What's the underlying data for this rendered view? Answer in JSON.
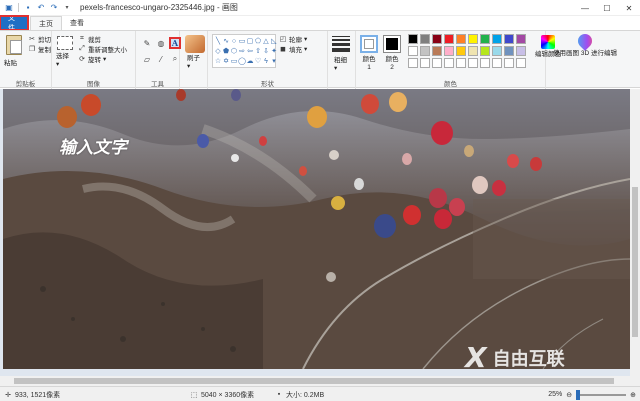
{
  "window": {
    "title": "pexels-francesco-ungaro-2325446.jpg - 画图",
    "minimize": "—",
    "maximize": "☐",
    "close": "✕"
  },
  "tabs": [
    {
      "label": "文件"
    },
    {
      "label": "主页"
    },
    {
      "label": "查看"
    }
  ],
  "ribbon": {
    "clipboard": {
      "paste": "粘贴",
      "cut": "剪切",
      "copy": "复制",
      "group": "剪贴板"
    },
    "image": {
      "select": "选择",
      "crop": "裁剪",
      "resize": "重新调整大小",
      "rotate": "旋转",
      "group": "图像"
    },
    "tools": {
      "group": "工具"
    },
    "brushes": {
      "label": "刷子"
    },
    "shapes": {
      "outline": "轮廓",
      "fill": "填充",
      "group": "形状"
    },
    "size": {
      "label": "粗细"
    },
    "colors": {
      "color1": "颜色 1",
      "color2": "颜色 2",
      "edit": "编辑颜色",
      "group": "颜色",
      "palette": [
        "#000000",
        "#7f7f7f",
        "#880015",
        "#ed1c24",
        "#ff7f27",
        "#fff200",
        "#22b14c",
        "#00a2e8",
        "#3f48cc",
        "#a349a4",
        "#ffffff",
        "#c3c3c3",
        "#b97a57",
        "#ffaec9",
        "#ffc90e",
        "#efe4b0",
        "#b5e61d",
        "#99d9ea",
        "#7092be",
        "#c8bfe7",
        "#ffffff",
        "#ffffff",
        "#ffffff",
        "#ffffff",
        "#ffffff",
        "#ffffff",
        "#ffffff",
        "#ffffff",
        "#ffffff",
        "#ffffff"
      ]
    },
    "paint3d": "使用画图 3D 进行编辑"
  },
  "canvas": {
    "overlay_text": "输入文字",
    "watermark": "自由互联",
    "watermark_mark": "X"
  },
  "status": {
    "cursor": "933, 1521像素",
    "dimensions": "5040 × 3360像素",
    "filesize": "大小: 0.2MB",
    "zoom": "25%"
  }
}
